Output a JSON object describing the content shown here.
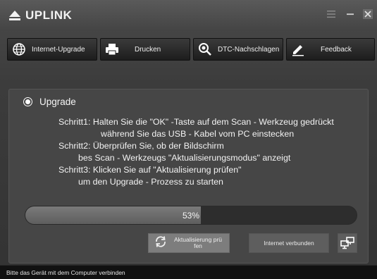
{
  "app": {
    "logo_text": "UPLINK"
  },
  "window_controls": {
    "menu_icon": "hamburger-icon",
    "minimize_icon": "minimize-icon",
    "close_icon": "close-icon"
  },
  "toolbar": {
    "items": [
      {
        "label": "Internet-Upgrade",
        "icon": "globe-icon"
      },
      {
        "label": "Drucken",
        "icon": "printer-icon"
      },
      {
        "label": "DTC-Nachschlagen",
        "icon": "search-gear-icon"
      },
      {
        "label": "Feedback",
        "icon": "pencil-icon"
      }
    ]
  },
  "upgrade": {
    "option_label": "Upgrade",
    "selected": true,
    "steps": [
      {
        "prefix": "Schritt1:",
        "line1": "Halten Sie die \"OK\" -Taste auf dem Scan - Werkzeug gedrückt",
        "line2": "während Sie das USB - Kabel vom PC einstecken"
      },
      {
        "prefix": "Schritt2:",
        "line1": "Überprüfen Sie, ob der Bildschirm",
        "line2": "bes Scan - Werkzeugs \"Aktualisierungsmodus\" anzeigt"
      },
      {
        "prefix": "Schritt3:",
        "line1": "Klicken Sie auf \"Aktualisierung prüfen\"",
        "line2": "um den Upgrade - Prozess zu starten"
      }
    ],
    "progress_percent": 53,
    "progress_text": "53%",
    "check_button": {
      "label_line1": "Aktualisierung prü",
      "label_line2": "fen",
      "icon": "refresh-icon"
    },
    "internet_status": "Internet verbunden",
    "network_icon": "network-connected-icon"
  },
  "statusbar": {
    "text": "Bitte das Gerät mit dem Computer verbinden"
  }
}
